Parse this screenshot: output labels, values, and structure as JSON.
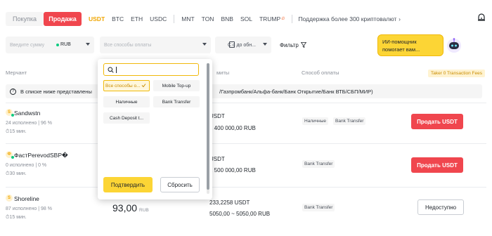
{
  "tabs": {
    "buy": "Покупка",
    "sell": "Продажа"
  },
  "coins": [
    "USDT",
    "BTC",
    "ETH",
    "USDC",
    "MNT",
    "TON",
    "BNB",
    "SOL",
    "TRUMP"
  ],
  "support_link": "Поддержка более 300 криптовалют",
  "filters": {
    "amount_placeholder": "Введите сумму",
    "currency": "RUB",
    "payment_placeholder": "Все способы оплаты",
    "date": "С с до обн...",
    "filter_label": "Фильтр"
  },
  "ai_bubble": "ИИ-помощник помогает вам...",
  "table_header": {
    "merchant": "Мерчант",
    "limits": "миты",
    "payment": "Способ оплаты",
    "taker": "Taker 0 Transaction Fees"
  },
  "notice": {
    "text_start": "В списке ниже представлены",
    "text_end": "/Газпромбанк/Альфа-банк/Банк Открытие/Банк ВТБ/СБП/МИР)"
  },
  "dropdown": {
    "options": [
      "Все способы о...",
      "Mobile Top-up",
      "Наличные",
      "Bank Transfer",
      "Cash Deposit t..."
    ],
    "confirm": "Подтвердить",
    "reset": "Сбросить"
  },
  "rows": [
    {
      "avatar": "S",
      "name": "Sandwstn",
      "stats": "24 исполнено  |  96 %",
      "time": "15 мин.",
      "price": "",
      "price_unit": "",
      "available": "USDT",
      "limit": "1 400 000,00 RUB",
      "payments": [
        "Наличные",
        "Bank Transfer"
      ],
      "action": "Продать USDT"
    },
    {
      "avatar": "Ф",
      "name": "ФастPerevodSBP�",
      "stats": "0 исполнено  |  0 %",
      "time": "30 мин.",
      "price": "",
      "price_unit": "",
      "available": "USDT",
      "limit": "1 500 000,00 RUB",
      "payments": [
        "Bank Transfer"
      ],
      "action": "Продать USDT"
    },
    {
      "avatar": "S",
      "name": "Shoreline",
      "stats": "87 исполнено  |  98 %",
      "time": "15 мин.",
      "price": "93,00",
      "price_unit": "RUB",
      "available": "233,2258 USDT",
      "limit": "5050,00 ~ 5050,00 RUB",
      "payments": [
        "Bank Transfer"
      ],
      "action": "Недоступно"
    }
  ],
  "colors": {
    "sell": "#f0464e",
    "accent": "#f0a500",
    "yellow": "#fcd535"
  }
}
